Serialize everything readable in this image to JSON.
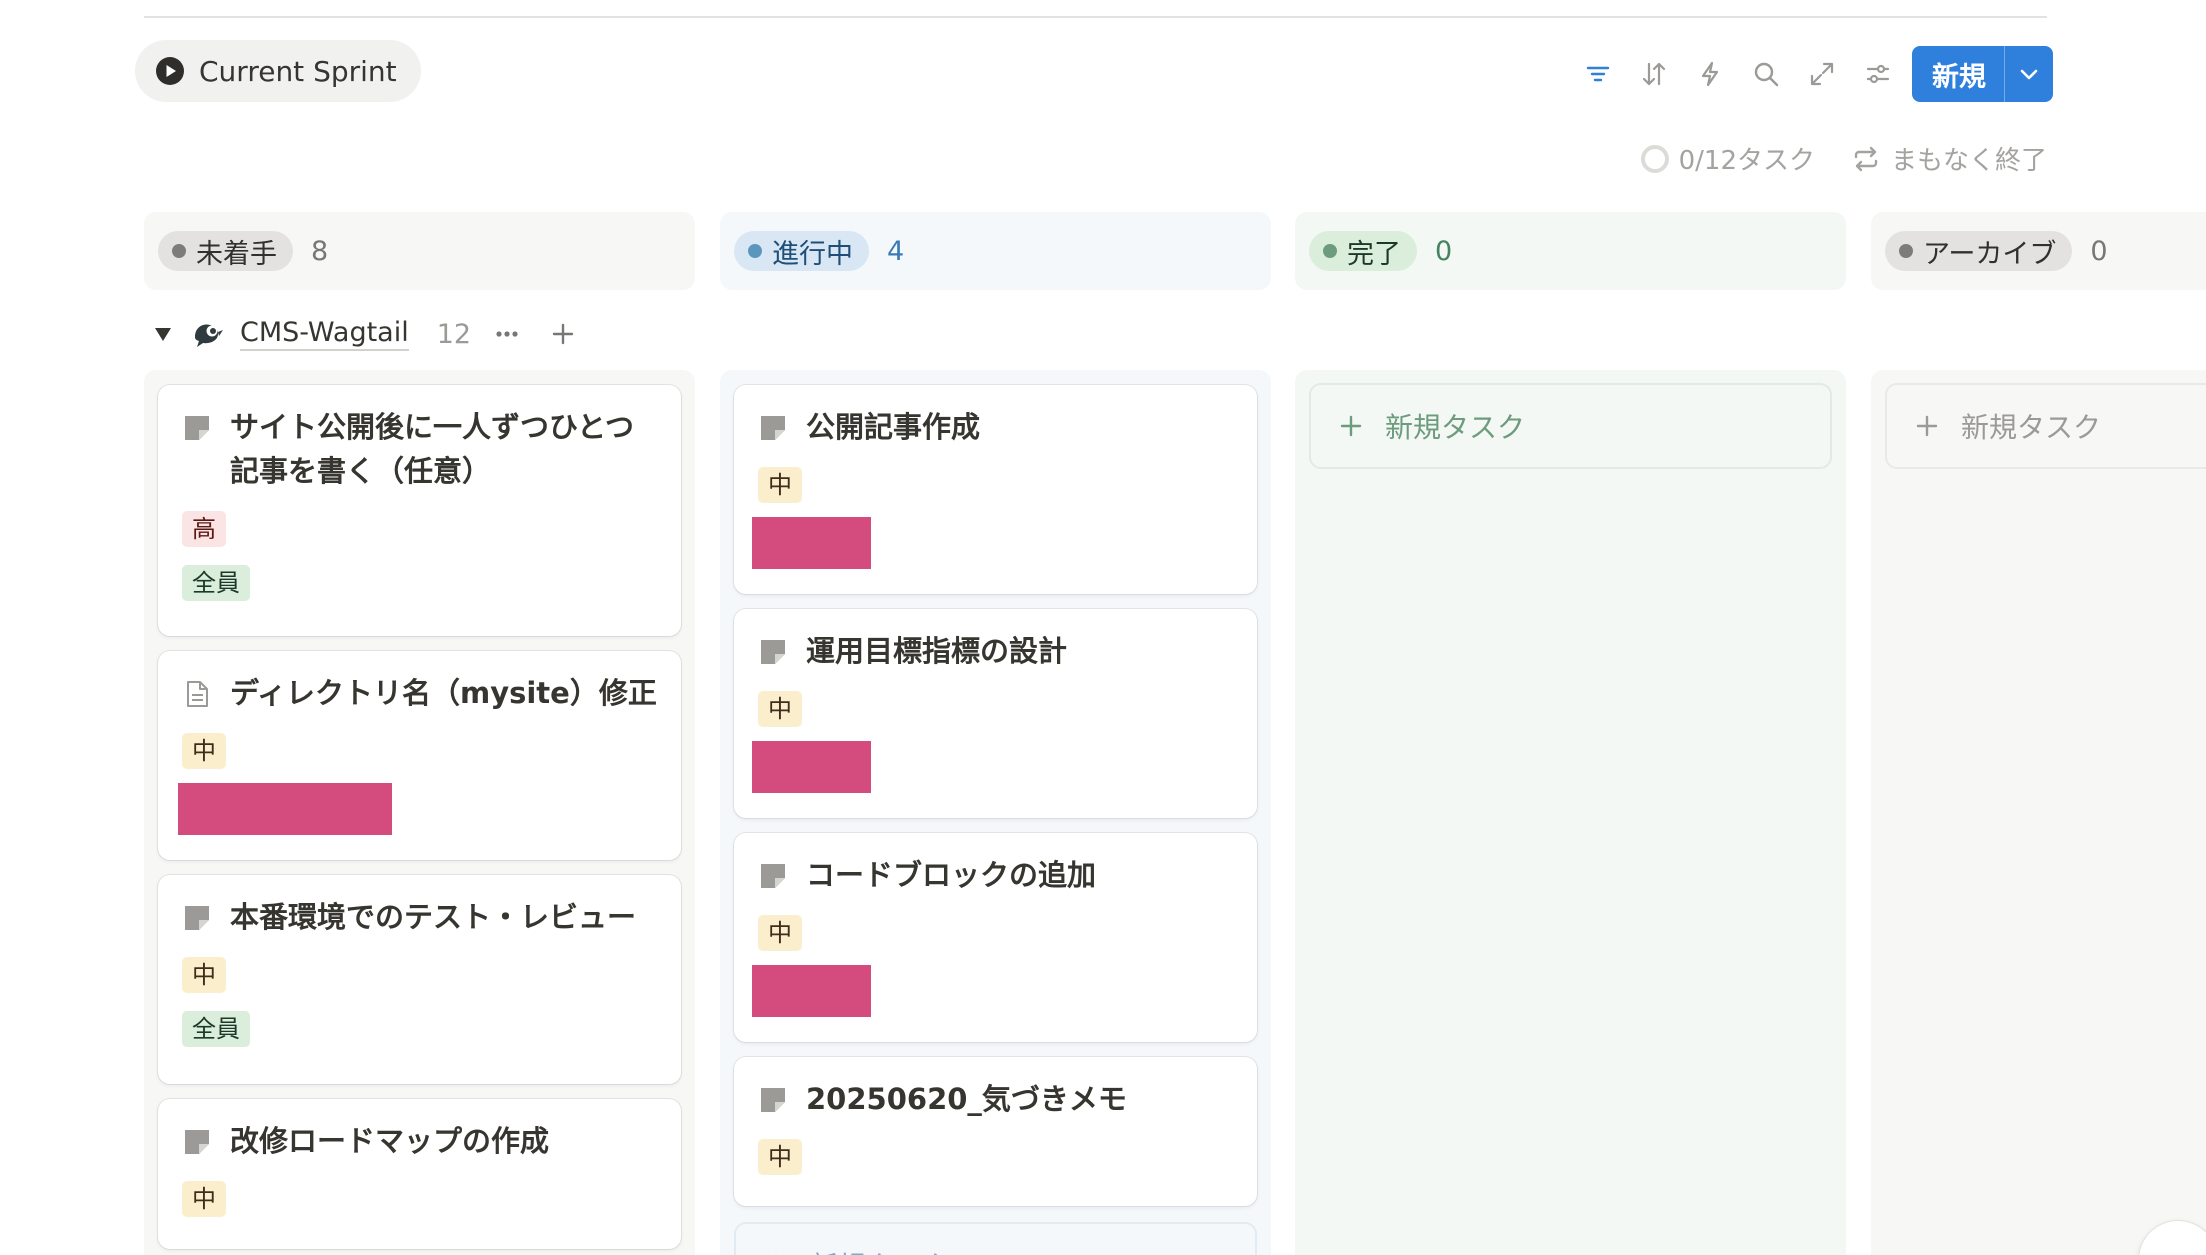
{
  "view": {
    "label": "Current Sprint",
    "icon": "play-circle-icon"
  },
  "toolbar": {
    "new_label": "新規",
    "accent": "#2f80dc",
    "icons": [
      "filter-icon",
      "sort-icon",
      "automation-icon",
      "search-icon",
      "expand-icon",
      "settings-icon"
    ]
  },
  "status": {
    "progress": "0/12タスク",
    "ending": "まもなく終了"
  },
  "columns": [
    {
      "name": "未着手",
      "count": "8"
    },
    {
      "name": "進行中",
      "count": "4"
    },
    {
      "name": "完了",
      "count": "0"
    },
    {
      "name": "アーカイブ",
      "count": "0"
    }
  ],
  "group": {
    "name": "CMS-Wagtail",
    "count": "12"
  },
  "labels": {
    "new_task": "新規タスク"
  },
  "todo_cards": [
    {
      "title": "サイト公開後に一人ずつひとつ記事を書く（任意）",
      "priority": "高",
      "assignee": "全員"
    },
    {
      "title": "ディレクトリ名（mysite）修正",
      "priority": "中"
    },
    {
      "title": "本番環境でのテスト・レビュー",
      "priority": "中",
      "assignee": "全員"
    },
    {
      "title": "改修ロードマップの作成",
      "priority": "中"
    }
  ],
  "progress_cards": [
    {
      "title": "公開記事作成",
      "priority": "中"
    },
    {
      "title": "運用目標指標の設計",
      "priority": "中"
    },
    {
      "title": "コードブロックの追加",
      "priority": "中"
    },
    {
      "title": "20250620_気づきメモ",
      "priority": "中"
    }
  ]
}
